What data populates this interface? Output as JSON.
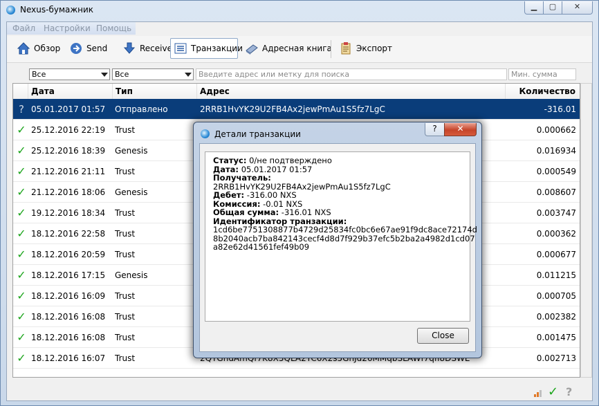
{
  "window": {
    "title": "Nexus-бумажник"
  },
  "menu": [
    "Файл",
    "Настройки",
    "Помощь"
  ],
  "toolbar": {
    "overview": "Обзор",
    "send": "Send",
    "receive": "Receive",
    "transactions": "Транзакции",
    "addressbook": "Адресная книга",
    "export": "Экспорт"
  },
  "filters": {
    "date": "Все",
    "type": "Все",
    "search_placeholder": "Введите адрес или метку для поиска",
    "min_amount_placeholder": "Мин. сумма"
  },
  "table": {
    "headers": {
      "date": "Дата",
      "type": "Тип",
      "address": "Адрес",
      "amount": "Количество"
    },
    "rows": [
      {
        "status": "?",
        "date": "05.01.2017 01:57",
        "type": "Отправлено",
        "address": "2RRB1HvYK29U2FB4Ax2jewPmAu1S5fz7LgC",
        "amount": "-316.01",
        "selected": true
      },
      {
        "status": "✓",
        "date": "25.12.2016 22:19",
        "type": "Trust",
        "address": "",
        "amount": "0.000662"
      },
      {
        "status": "✓",
        "date": "25.12.2016 18:39",
        "type": "Genesis",
        "address": "",
        "amount": "0.016934"
      },
      {
        "status": "✓",
        "date": "21.12.2016 21:11",
        "type": "Trust",
        "address": "",
        "amount": "0.000549"
      },
      {
        "status": "✓",
        "date": "21.12.2016 18:06",
        "type": "Genesis",
        "address": "",
        "amount": "0.008607"
      },
      {
        "status": "✓",
        "date": "19.12.2016 18:34",
        "type": "Trust",
        "address": "",
        "amount": "0.003747"
      },
      {
        "status": "✓",
        "date": "18.12.2016 22:58",
        "type": "Trust",
        "address": "",
        "amount": "0.000362"
      },
      {
        "status": "✓",
        "date": "18.12.2016 20:59",
        "type": "Trust",
        "address": "",
        "amount": "0.000677"
      },
      {
        "status": "✓",
        "date": "18.12.2016 17:15",
        "type": "Genesis",
        "address": "",
        "amount": "0.011215"
      },
      {
        "status": "✓",
        "date": "18.12.2016 16:09",
        "type": "Trust",
        "address": "",
        "amount": "0.000705"
      },
      {
        "status": "✓",
        "date": "18.12.2016 16:08",
        "type": "Trust",
        "address": "",
        "amount": "0.002382"
      },
      {
        "status": "✓",
        "date": "18.12.2016 16:08",
        "type": "Trust",
        "address": "",
        "amount": "0.001475"
      },
      {
        "status": "✓",
        "date": "18.12.2016 16:07",
        "type": "Trust",
        "address": "2QTGhdAmQf7K8X5QLA2YC6X2s5GhJd26MMqbSLAWf7qfl8DSWE",
        "amount": "0.002713"
      }
    ]
  },
  "dialog": {
    "title": "Детали транзакции",
    "status_label": "Статус:",
    "status_value": "0/не подтверждено",
    "date_label": "Дата:",
    "date_value": "05.01.2017 01:57",
    "recipient_label": "Получатель:",
    "recipient_value": "2RRB1HvYK29U2FB4Ax2jewPmAu1S5fz7LgC",
    "debit_label": "Дебет:",
    "debit_value": "-316.00 NXS",
    "fee_label": "Комиссия:",
    "fee_value": "-0.01 NXS",
    "total_label": "Общая сумма:",
    "total_value": "-316.01 NXS",
    "txid_label": "Идентификатор транзакции:",
    "txid_line1": "1cd6be7751308877b4729d25834fc0bc6e67ae91f9dc8ace72174d",
    "txid_line2": "8b2040acb7ba842143cecf4d8d7f929b37efc5b2ba2a4982d1cd07",
    "txid_line3": "a82e62d41561fef49b09",
    "close": "Close"
  },
  "colors": {
    "selection": "#0a3d7a",
    "confirmed": "#1ca51c"
  }
}
